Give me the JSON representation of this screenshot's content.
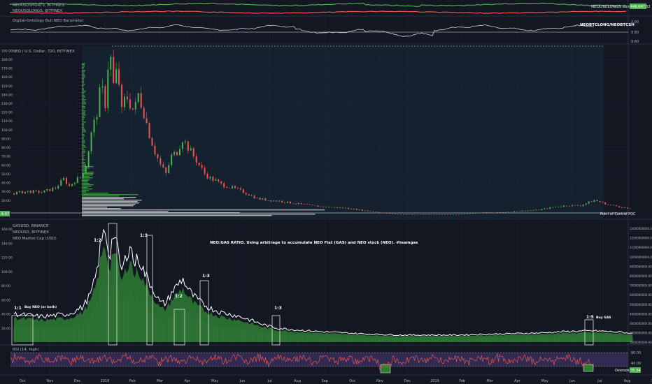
{
  "colors": {
    "background": "#131722",
    "grid": "#1e2230",
    "text": "#b2b5be",
    "white_text": "#ffffff",
    "up": "#4caf50",
    "down": "#ef5350",
    "price_line": "#e0e0e0",
    "volume_profile": "#c8c8c8",
    "volume_profile_green": "#4caf50",
    "rsi_band": "#4b3a7a",
    "rsi_line": "#ef5350",
    "mcap_fill": "#1b5e20",
    "mcap_fill_light": "#9ccc9c",
    "highlight_box": "#3a5a8a"
  },
  "panes": {
    "longs_shorts": {
      "label1": "NEOUSDSHORTS, BITFINEX",
      "label2": "NEOUSDLONGS, BITFINEX",
      "legend": "NEOUSDLONGS dominant",
      "value_tag": "448,647.52"
    },
    "barometer": {
      "label": "Digital-Ontology Bull NEO Barometer",
      "legend": "NEOBTCLONG/NEOBTCSH",
      "ticks": [
        "2.00",
        "0.80",
        "0.60"
      ]
    },
    "main": {
      "label": "NEO / U.S. Dollar, 720, BITFINEX",
      "y_ticks": [
        "190.00",
        "180.00",
        "170.00",
        "160.00",
        "150.00",
        "140.00",
        "130.00",
        "120.00",
        "110.00",
        "100.00",
        "90.00",
        "80.00",
        "70.00",
        "60.00",
        "50.00",
        "40.00",
        "30.00",
        "20.00"
      ],
      "price_tag": "6.97",
      "poc_label": "Point of Control POC"
    },
    "ratio": {
      "label1": "GASUSD, BINANCE",
      "label2": "NEOUSD, BITFINEX",
      "label3": "NEO Market Cap (USD)",
      "annotation": "NEO:GAS RATIO. Using arbitrage to accumulate NEO Fiat (GAS) and NEO stock (NEO). #teamgas",
      "left_ticks": [
        "160.00",
        "140.00",
        "120.00",
        "100.00",
        "80.00",
        "60.00",
        "40.00",
        "20.00"
      ],
      "right_ticks": [
        "13000000000.00",
        "12000000000.00",
        "11000000000.00",
        "10000000000.00",
        "9000000000.00",
        "8000000000.00",
        "7000000000.00",
        "6000000000.00",
        "5000000000.00",
        "4000000000.00",
        "3000000000.00",
        "2000000000.00",
        "1000000000.00"
      ],
      "notes": [
        {
          "text": "1:1",
          "bold": true
        },
        {
          "text": "Buy NEO (or both)",
          "bold": true
        },
        {
          "text": "1:2",
          "bold": true
        },
        {
          "text": "1:3",
          "bold": true
        },
        {
          "text": "1:2",
          "bold": true
        },
        {
          "text": "1:3",
          "bold": true
        },
        {
          "text": "1:3",
          "bold": true
        },
        {
          "text": "1:5",
          "bold": true
        },
        {
          "text": "Buy GAS",
          "bold": true
        }
      ]
    },
    "rsi": {
      "label": "RSI (14, high)",
      "ticks": [
        "80.00",
        "40.00"
      ],
      "oversold_label": "Oversold",
      "value_tag": "35.34"
    }
  },
  "x_axis": [
    "Oct",
    "Nov",
    "Dec",
    "2018",
    "Feb",
    "Mar",
    "Apr",
    "May",
    "Jun",
    "Jul",
    "Aug",
    "Sep",
    "Oct",
    "Nov",
    "Dec",
    "2019",
    "Feb",
    "Mar",
    "Apr",
    "May",
    "Jun",
    "Jul",
    "Aug",
    "Sep"
  ],
  "chart_data": {
    "type": "line",
    "title": "NEO / U.S. Dollar, 720, BITFINEX",
    "x_unit": "months from Oct 2017 (0 = Oct 2017)",
    "ylim": [
      0,
      195
    ],
    "series": [
      {
        "name": "NEO / U.S. Dollar",
        "x": [
          0,
          0.5,
          1,
          1.5,
          1.8,
          2,
          2.2,
          2.4,
          2.6,
          2.8,
          3,
          3.15,
          3.3,
          3.45,
          3.6,
          3.75,
          3.9,
          4.05,
          4.2,
          4.35,
          4.5,
          4.7,
          4.9,
          5.1,
          5.3,
          5.5,
          5.7,
          5.9,
          6.1,
          6.3,
          6.5,
          6.7,
          6.9,
          7.1,
          7.3,
          7.5,
          7.8,
          8.1,
          8.4,
          8.8,
          9.2,
          9.6,
          10,
          10.5,
          11,
          11.5,
          12,
          12.5,
          13,
          13.5,
          14,
          14.5,
          15,
          15.5,
          16,
          16.5,
          17,
          17.5,
          18,
          18.5,
          19,
          19.5,
          20,
          20.5,
          21,
          21.5,
          22,
          22.4
        ],
        "values": [
          28,
          30,
          29,
          34,
          44,
          36,
          42,
          46,
          60,
          95,
          120,
          150,
          130,
          195,
          150,
          170,
          120,
          140,
          130,
          120,
          140,
          120,
          95,
          75,
          60,
          50,
          70,
          75,
          90,
          80,
          70,
          60,
          50,
          45,
          42,
          38,
          35,
          32,
          28,
          22,
          20,
          19,
          17,
          15,
          13,
          12,
          11,
          9,
          7,
          5,
          4,
          4,
          4,
          4,
          4,
          5,
          6,
          6,
          7,
          8,
          9,
          12,
          14,
          14,
          20,
          15,
          12,
          9
        ]
      },
      {
        "name": "GASUSD / NEO Market Cap",
        "x": [
          0,
          0.5,
          1,
          1.5,
          2,
          2.5,
          2.8,
          3,
          3.15,
          3.3,
          3.45,
          3.6,
          3.75,
          3.9,
          4.05,
          4.2,
          4.35,
          4.5,
          4.7,
          4.9,
          5.1,
          5.3,
          5.5,
          5.7,
          5.9,
          6.1,
          6.3,
          6.5,
          6.8,
          7.1,
          7.5,
          8,
          8.5,
          9,
          9.5,
          10,
          11,
          12,
          13,
          14,
          15,
          16,
          17,
          18,
          19,
          20,
          21,
          22,
          22.4
        ],
        "values": [
          40,
          38,
          36,
          38,
          40,
          50,
          70,
          100,
          140,
          160,
          120,
          155,
          130,
          100,
          120,
          140,
          110,
          120,
          100,
          85,
          70,
          55,
          55,
          70,
          80,
          90,
          75,
          65,
          55,
          48,
          42,
          38,
          32,
          25,
          20,
          18,
          15,
          13,
          11,
          10,
          10,
          10,
          11,
          12,
          13,
          15,
          16,
          14,
          12
        ]
      }
    ]
  }
}
